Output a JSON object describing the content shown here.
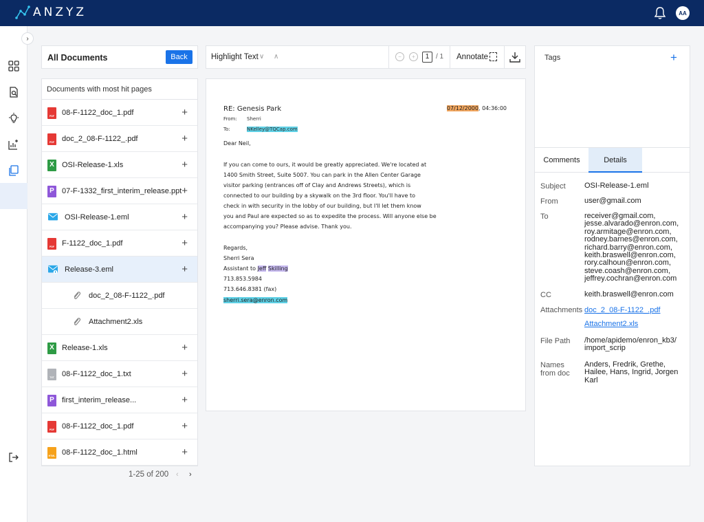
{
  "app": {
    "brand": "ANZYZ",
    "user_initials": "AA"
  },
  "documents": {
    "panel_title": "All Documents",
    "back_label": "Back",
    "section_title": "Documents with most hit pages",
    "rows": [
      {
        "name": "08-F-1122_doc_1.pdf",
        "type": "pdf",
        "type_label": "PDF"
      },
      {
        "name": "doc_2_08-F-1122_.pdf",
        "type": "pdf",
        "type_label": "PDF"
      },
      {
        "name": "OSI-Release-1.xls",
        "type": "xls",
        "type_label": "X"
      },
      {
        "name": "07-F-1332_first_interim_release.ppt",
        "type": "ppt",
        "type_label": "P"
      },
      {
        "name": "OSI-Release-1.eml",
        "type": "eml"
      },
      {
        "name": "F-1122_doc_1.pdf",
        "type": "pdf",
        "type_label": "PDF"
      },
      {
        "name": "Release-3.eml",
        "type": "eml-attach"
      },
      {
        "name": "doc_2_08-F-1122_.pdf",
        "type": "attachment"
      },
      {
        "name": "Attachment2.xls",
        "type": "attachment"
      },
      {
        "name": "Release-1.xls",
        "type": "xls",
        "type_label": "X"
      },
      {
        "name": "08-F-1122_doc_1.txt",
        "type": "txt",
        "type_label": "TXT"
      },
      {
        "name": "first_interim_release...",
        "type": "ppt",
        "type_label": "P"
      },
      {
        "name": "08-F-1122_doc_1.pdf",
        "type": "pdf",
        "type_label": "PDF"
      },
      {
        "name": "08-F-1122_doc_1.html",
        "type": "html",
        "type_label": "HTML"
      }
    ],
    "add_symbol": "+",
    "pagination": {
      "range": "1-25 of 200",
      "prev": "‹",
      "next": "›"
    }
  },
  "toolbar": {
    "highlight_label": "Highlight Text",
    "page_current": "1",
    "page_total": "/ 1",
    "annotate_label": "Annotate"
  },
  "email": {
    "subject": "RE: Genesis Park",
    "date": "07/12/2000",
    "time": ", 04:36:00",
    "from_label": "From:",
    "from_value": "Sherri",
    "to_label": "To:",
    "to_value": "NKelley@TQCap.com",
    "greeting": "Dear Neil,",
    "body": [
      "If you can come to ours, it would be greatly appreciated. We're located at",
      "1400 Smith Street, Suite 5007. You can park in the Allen Center Garage",
      "visitor parking (entrances off of Clay and Andrews Streets), which is",
      "connected to our building by a skywalk on the 3rd floor. You'll have to",
      "check in with security in the lobby of our building, but I'll let them know",
      "you and Paul are expected so as to expedite the process. Will anyone else be",
      "accompanying you? Please advise. Thank you."
    ],
    "closing": "Regards,",
    "signature_name": "Sherri Sera",
    "assistant_prefix": "Assistant to ",
    "assistant_first": "Jeff",
    "assistant_last": "Skilling",
    "phone": "713.853.5984",
    "fax": "713.646.8381 (fax)",
    "signature_email": "sherri.sera@enron.com"
  },
  "right_panel": {
    "tags_title": "Tags",
    "tags_add": "+",
    "tabs": [
      "Comments",
      "Details"
    ],
    "details": {
      "subject_label": "Subject",
      "subject": "OSI-Release-1.eml",
      "from_label": "From",
      "from": "user@gmail.com",
      "to_label": "To",
      "to": [
        "receiver@gmail.com,",
        "jesse.alvarado@enron.com,",
        "roy.armitage@enron.com,",
        "rodney.barnes@enron.com,",
        "richard.barry@enron.com,",
        "keith.braswell@enron.com,",
        "rory.calhoun@enron.com,",
        "steve.coash@enron.com,",
        "jeffrey.cochran@enron.com"
      ],
      "cc_label": "CC",
      "cc": "keith.braswell@enron.com",
      "attachments_label": "Attachments",
      "attachments": [
        "doc_2_08-F-1122_.pdf",
        "Attachment2.xls"
      ],
      "filepath_label": "File Path",
      "filepath": [
        "/home/apidemo/enron_kb3/",
        "import_scrip"
      ],
      "names_label": [
        "Names",
        "from doc"
      ],
      "names": [
        "Anders, Fredrik, Grethe,",
        "Hailee, Hans, Ingrid, Jorgen",
        "Karl"
      ]
    }
  },
  "colors": {
    "brand_bar": "#0b2a63",
    "accent": "#1a73e8",
    "selected_row": "#e7f0fb"
  },
  "icons": [
    "bell-icon",
    "grid-icon",
    "search-docs-icon",
    "bulb-icon",
    "analytics-icon",
    "documents-icon",
    "logout-icon",
    "download-icon",
    "marquee-icon",
    "paperclip-icon"
  ]
}
